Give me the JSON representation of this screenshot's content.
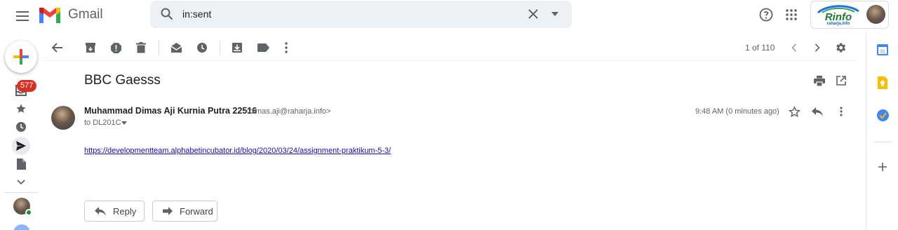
{
  "header": {
    "app_name": "Gmail",
    "search_value": "in:sent",
    "org_logo_text": "Rinfo",
    "org_logo_sub": "raharja.info"
  },
  "nav": {
    "inbox_count": "577"
  },
  "toolbar": {
    "pager": "1 of 110"
  },
  "message": {
    "subject": "BBC Gaesss",
    "sender_name": "Muhammad Dimas Aji Kurnia Putra 22516",
    "sender_email": "<dimas.aji@raharja.info>",
    "recipient": "to DL201C",
    "timestamp": "9:48 AM (0 minutes ago)",
    "body_link": "https://developmentteam.alphabetincubator.id/blog/2020/03/24/assignment-praktikum-5-3/"
  },
  "actions": {
    "reply_label": "Reply",
    "forward_label": "Forward"
  },
  "colors": {
    "gmail_red": "#ea4335",
    "badge_red": "#d93025",
    "link": "#1a0dab",
    "icon_gray": "#5f6368"
  }
}
